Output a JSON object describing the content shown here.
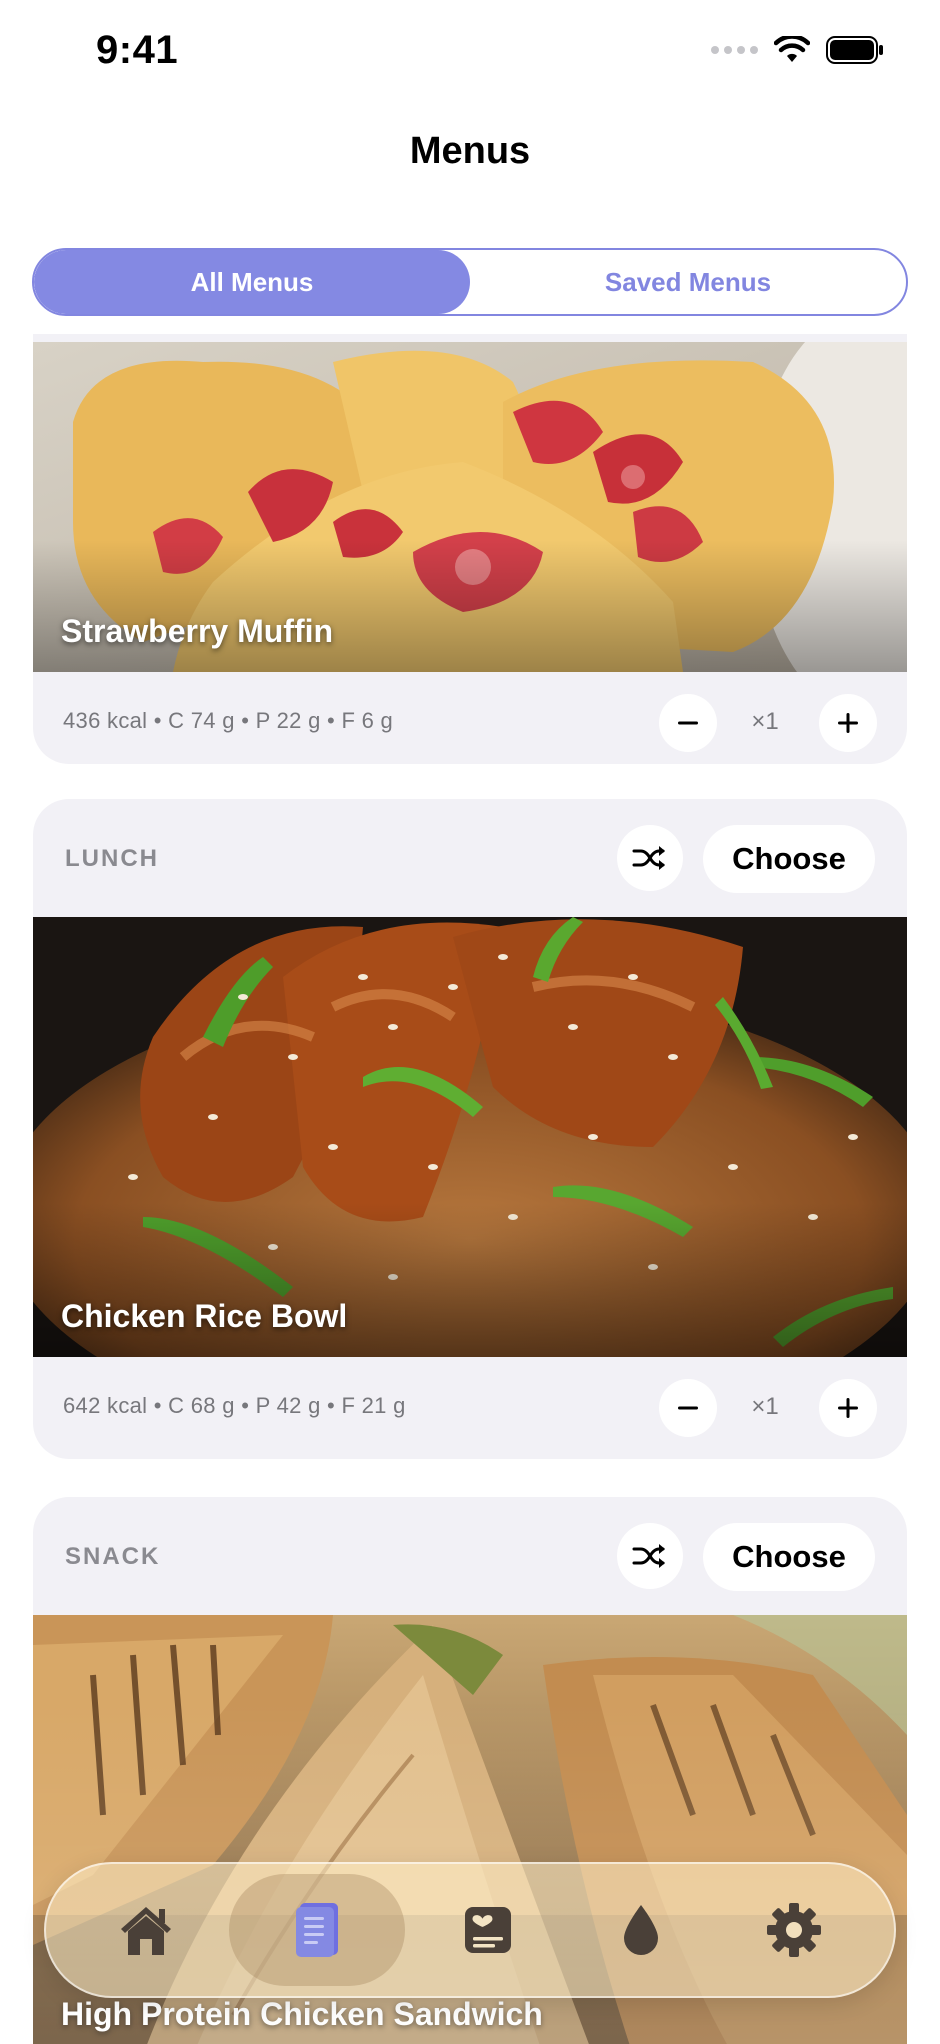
{
  "status_bar": {
    "time": "9:41"
  },
  "nav": {
    "title": "Menus"
  },
  "segments": {
    "all": "All Menus",
    "saved": "Saved Menus"
  },
  "cards": [
    {
      "meal": "",
      "food_name": "Strawberry Muffin",
      "macros": "436 kcal • C 74 g • P 22 g • F 6 g",
      "quantity": "×1"
    },
    {
      "meal": "LUNCH",
      "choose_label": "Choose",
      "food_name": "Chicken Rice Bowl",
      "macros": "642 kcal • C 68 g • P 42 g • F 21 g",
      "quantity": "×1"
    },
    {
      "meal": "SNACK",
      "choose_label": "Choose",
      "food_name": "High Protein Chicken Sandwich"
    }
  ],
  "tab_bar": {
    "tabs": [
      {
        "icon": "home-icon"
      },
      {
        "icon": "menu-book-icon",
        "active": true
      },
      {
        "icon": "journal-heart-icon"
      },
      {
        "icon": "water-drop-icon"
      },
      {
        "icon": "settings-gear-icon"
      }
    ]
  },
  "colors": {
    "accent": "#8489e3",
    "card_bg": "#f2f1f6",
    "muted_text": "#77777c"
  }
}
